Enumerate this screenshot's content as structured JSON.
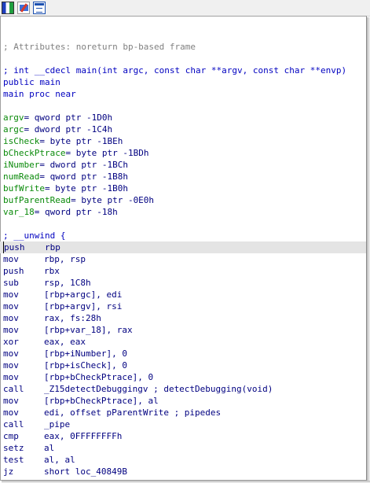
{
  "toolbar": {
    "icons": [
      "graph-view-icon",
      "edit-icon",
      "window-icon"
    ]
  },
  "listing": {
    "attributes_comment": "; Attributes: noreturn bp-based frame",
    "prototype": "; int __cdecl main(int argc, const char **argv, const char **envp)",
    "public": "public main",
    "proc": "main proc near",
    "vars": [
      {
        "name": "argv",
        "def": "= qword ptr -1D0h"
      },
      {
        "name": "argc",
        "def": "= dword ptr -1C4h"
      },
      {
        "name": "isCheck",
        "def": "= byte ptr -1BEh"
      },
      {
        "name": "bCheckPtrace",
        "def": "= byte ptr -1BDh"
      },
      {
        "name": "iNumber",
        "def": "= dword ptr -1BCh"
      },
      {
        "name": "numRead",
        "def": "= qword ptr -1B8h"
      },
      {
        "name": "bufWrite",
        "def": "= byte ptr -1B0h"
      },
      {
        "name": "bufParentRead",
        "def": "= byte ptr -0E0h"
      },
      {
        "name": "var_18",
        "def": "= qword ptr -18h"
      }
    ],
    "unwind": "; __unwind {",
    "instructions": [
      {
        "mnem": "push",
        "ops": "rbp",
        "highlight": true
      },
      {
        "mnem": "mov",
        "ops": "rbp, rsp"
      },
      {
        "mnem": "push",
        "ops": "rbx"
      },
      {
        "mnem": "sub",
        "ops": "rsp, 1C8h"
      },
      {
        "mnem": "mov",
        "ops": "[rbp+argc], edi"
      },
      {
        "mnem": "mov",
        "ops": "[rbp+argv], rsi"
      },
      {
        "mnem": "mov",
        "ops": "rax, fs:28h"
      },
      {
        "mnem": "mov",
        "ops": "[rbp+var_18], rax"
      },
      {
        "mnem": "xor",
        "ops": "eax, eax"
      },
      {
        "mnem": "mov",
        "ops": "[rbp+iNumber], 0"
      },
      {
        "mnem": "mov",
        "ops": "[rbp+isCheck], 0"
      },
      {
        "mnem": "mov",
        "ops": "[rbp+bCheckPtrace], 0"
      },
      {
        "mnem": "call",
        "ops": "_Z15detectDebuggingv ; detectDebugging(void)"
      },
      {
        "mnem": "mov",
        "ops": "[rbp+bCheckPtrace], al"
      },
      {
        "mnem": "mov",
        "ops": "edi, offset pParentWrite ; pipedes"
      },
      {
        "mnem": "call",
        "ops": "_pipe"
      },
      {
        "mnem": "cmp",
        "ops": "eax, 0FFFFFFFFh"
      },
      {
        "mnem": "setz",
        "ops": "al"
      },
      {
        "mnem": "test",
        "ops": "al, al"
      },
      {
        "mnem": "jz",
        "ops": "short loc_40849B"
      }
    ]
  }
}
